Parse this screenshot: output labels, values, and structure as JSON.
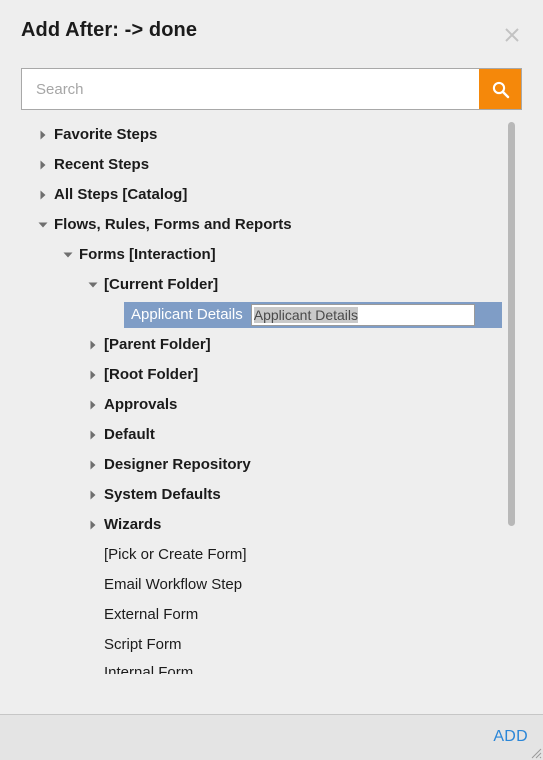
{
  "dialog": {
    "title": "Add After: -> done",
    "close_icon": "close-icon",
    "accent_orange": "#f5880a",
    "selection_blue": "#7f9dc6",
    "link_blue": "#2a86d8",
    "background": "#eeeeee",
    "footer_background": "#e4e4e4"
  },
  "search": {
    "placeholder": "Search",
    "value": "",
    "button_icon": "search-icon"
  },
  "tree": {
    "nodes": [
      {
        "label": "Favorite Steps",
        "depth": 0,
        "bold": true,
        "state": "collapsed"
      },
      {
        "label": "Recent Steps",
        "depth": 0,
        "bold": true,
        "state": "collapsed"
      },
      {
        "label": "All Steps [Catalog]",
        "depth": 0,
        "bold": true,
        "state": "collapsed"
      },
      {
        "label": "Flows, Rules, Forms and Reports",
        "depth": 0,
        "bold": true,
        "state": "expanded"
      },
      {
        "label": "Forms [Interaction]",
        "depth": 1,
        "bold": true,
        "state": "expanded"
      },
      {
        "label": "[Current Folder]",
        "depth": 2,
        "bold": true,
        "state": "expanded"
      },
      {
        "label": "Applicant Details",
        "depth": 3,
        "bold": false,
        "state": "editing"
      },
      {
        "label": "[Parent Folder]",
        "depth": 2,
        "bold": true,
        "state": "collapsed"
      },
      {
        "label": "[Root Folder]",
        "depth": 2,
        "bold": true,
        "state": "collapsed"
      },
      {
        "label": "Approvals",
        "depth": 2,
        "bold": true,
        "state": "collapsed"
      },
      {
        "label": "Default",
        "depth": 2,
        "bold": true,
        "state": "collapsed"
      },
      {
        "label": "Designer Repository",
        "depth": 2,
        "bold": true,
        "state": "collapsed"
      },
      {
        "label": "System Defaults",
        "depth": 2,
        "bold": true,
        "state": "collapsed"
      },
      {
        "label": "Wizards",
        "depth": 2,
        "bold": true,
        "state": "collapsed"
      },
      {
        "label": "[Pick or Create Form]",
        "depth": 2,
        "bold": false,
        "state": "leaf"
      },
      {
        "label": "Email Workflow Step",
        "depth": 2,
        "bold": false,
        "state": "leaf"
      },
      {
        "label": "External Form",
        "depth": 2,
        "bold": false,
        "state": "leaf"
      },
      {
        "label": "Script Form",
        "depth": 2,
        "bold": false,
        "state": "leaf"
      },
      {
        "label": "Internal Form",
        "depth": 2,
        "bold": false,
        "state": "leaf-clipped"
      }
    ],
    "selected_label": "Applicant Details",
    "edit_value": "Applicant Details"
  },
  "footer": {
    "add_label": "ADD",
    "resize_icon": "resize-grip-icon"
  }
}
